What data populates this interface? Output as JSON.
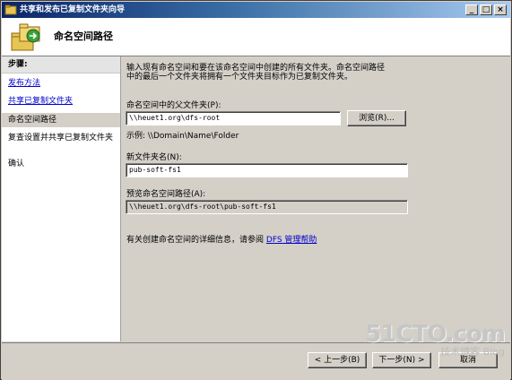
{
  "window": {
    "title": "共享和发布已复制文件夹向导"
  },
  "header": {
    "title": "命名空间路径"
  },
  "sidebar": {
    "heading": "步骤:",
    "steps": [
      {
        "label": "发布方法",
        "state": "link"
      },
      {
        "label": "共享已复制文件夹",
        "state": "link"
      },
      {
        "label": "命名空间路径",
        "state": "current"
      },
      {
        "label": "复查设置并共享已复制文件夹",
        "state": "normal"
      },
      {
        "label": "确认",
        "state": "normal"
      }
    ]
  },
  "main": {
    "description_line1": "输入现有命名空间和要在该命名空间中创建的所有文件夹。命名空间路径",
    "description_line2": "中的最后一个文件夹将拥有一个文件夹目标作为已复制文件夹。",
    "parent_folder_label": "命名空间中的父文件夹(P):",
    "parent_folder_value": "\\\\heuet1.org\\dfs-root",
    "browse_label": "浏览(R)...",
    "example_text": "示例: \\\\Domain\\Name\\Folder",
    "new_folder_label": "新文件夹名(N):",
    "new_folder_value": "pub-soft-fs1",
    "preview_label": "预览命名空间路径(A):",
    "preview_value": "\\\\heuet1.org\\dfs-root\\pub-soft-fs1",
    "help_prefix": "有关创建命名空间的详细信息，请参阅",
    "help_link": "DFS 管理帮助"
  },
  "footer": {
    "back_label": "< 上一步(B)",
    "next_label": "下一步(N) >",
    "cancel_label": "取消"
  },
  "watermark": {
    "main": "51CTO.com",
    "sub": "技术博客 Blog"
  },
  "colors": {
    "titlebar_start": "#0a246a",
    "titlebar_end": "#a6caf0",
    "link": "#0000cc",
    "face": "#d4d0c8"
  },
  "icons": {
    "title": "wizard-window-icon",
    "header": "shared-folders-icon"
  }
}
